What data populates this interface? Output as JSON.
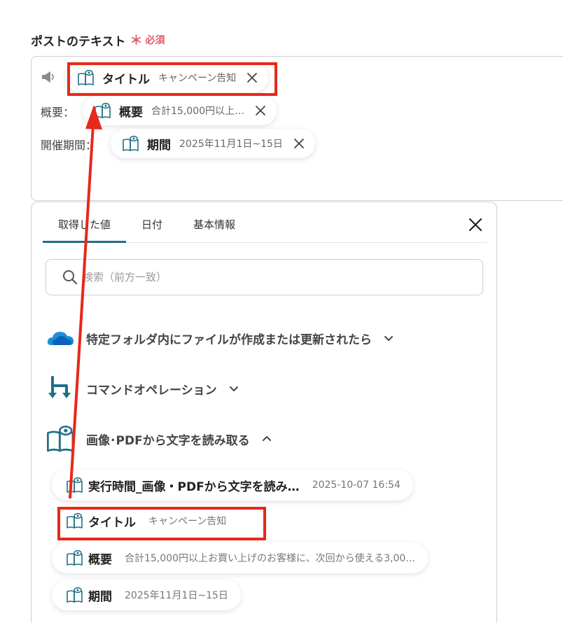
{
  "field": {
    "label": "ポストのテキスト",
    "required_star": "＊",
    "required_text": "必須"
  },
  "editor": {
    "lines": [
      {
        "label": "",
        "chip": {
          "name": "タイトル",
          "value": "キャンペーン告知"
        }
      },
      {
        "label": "概要：",
        "chip": {
          "name": "概要",
          "value": "合計15,000円以上…"
        }
      },
      {
        "label": "開催期間：",
        "chip": {
          "name": "期間",
          "value": "2025年11月1日~15日"
        }
      }
    ]
  },
  "panel": {
    "tabs": [
      {
        "label": "取得した値",
        "active": true
      },
      {
        "label": "日付",
        "active": false
      },
      {
        "label": "基本情報",
        "active": false
      }
    ],
    "search": {
      "placeholder": "検索（前方一致）",
      "value": ""
    },
    "sections": [
      {
        "label": "特定フォルダ内にファイルが作成または更新されたら",
        "icon": "onedrive-cloud-icon",
        "expanded": false
      },
      {
        "label": "コマンドオペレーション",
        "icon": "command-operation-icon",
        "expanded": false
      },
      {
        "label": "画像･PDFから文字を読み取る",
        "icon": "ocr-book-icon",
        "expanded": true
      }
    ],
    "results": [
      {
        "name": "実行時間_画像・PDFから文字を読み…",
        "value": "2025-10-07 16:54"
      },
      {
        "name": "タイトル",
        "value": "キャンペーン告知"
      },
      {
        "name": "概要",
        "value": "合計15,000円以上お買い上げのお客様に、次回から使える3,00…"
      },
      {
        "name": "期間",
        "value": "2025年11月1日~15日"
      }
    ]
  },
  "colors": {
    "accent_tab": "#1f6f87",
    "annotation_red": "#e8281a",
    "required_red": "#e05a6d",
    "ocr_icon": "#1f6f87"
  }
}
